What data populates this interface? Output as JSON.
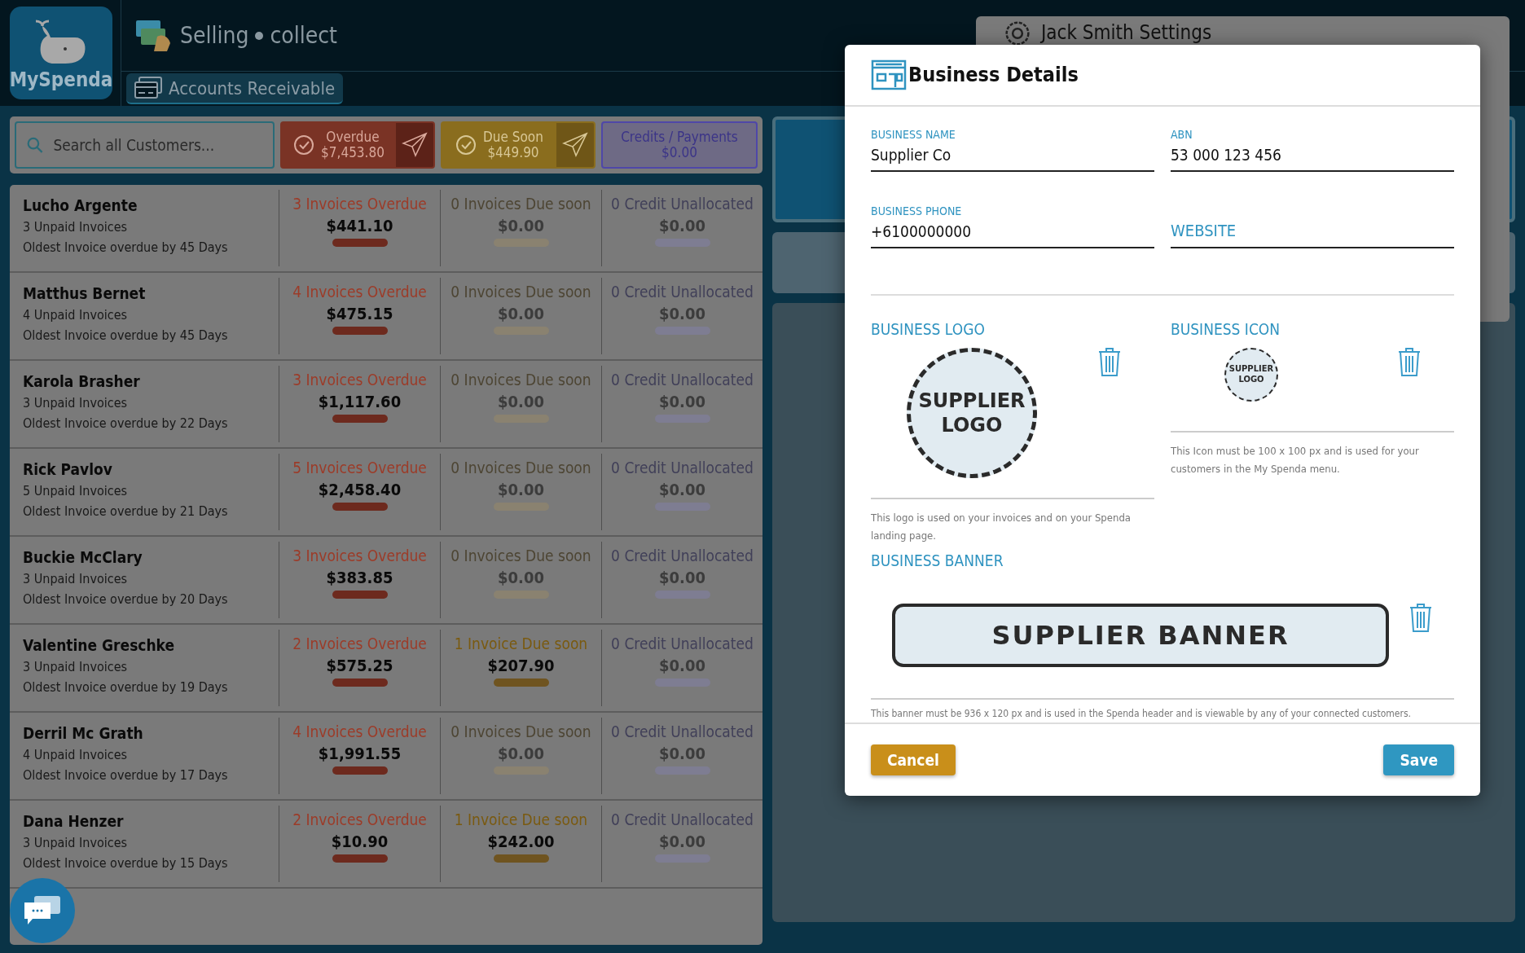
{
  "app": {
    "logo_text": "MySpenda",
    "section_title": "Selling",
    "section_subtitle": "collect",
    "tab": {
      "label": "Accounts Receivable",
      "selected": true
    }
  },
  "filters": {
    "search": {
      "placeholder": "Search all Customers..."
    },
    "buttons": [
      {
        "kind": "overdue",
        "label": "Overdue",
        "amount": "$7,453.80",
        "send": true
      },
      {
        "kind": "due",
        "label": "Due Soon",
        "amount": "$449.90",
        "send": true
      },
      {
        "kind": "credit",
        "label": "Credits / Payments",
        "amount": "$0.00",
        "send": false
      }
    ]
  },
  "customers": [
    {
      "name": "Lucho Argente",
      "unpaid": "3 Unpaid Invoices",
      "oldest": "Oldest Invoice overdue by 45 Days",
      "overdue": {
        "label": "3 Invoices Overdue",
        "amount": "$441.10",
        "active": true
      },
      "due": {
        "label": "0 Invoices Due soon",
        "amount": "$0.00",
        "active": false
      },
      "credit": {
        "label": "0 Credit Unallocated",
        "amount": "$0.00",
        "active": false
      }
    },
    {
      "name": "Matthus Bernet",
      "unpaid": "4 Unpaid Invoices",
      "oldest": "Oldest Invoice overdue by 45 Days",
      "overdue": {
        "label": "4 Invoices Overdue",
        "amount": "$475.15",
        "active": true
      },
      "due": {
        "label": "0 Invoices Due soon",
        "amount": "$0.00",
        "active": false
      },
      "credit": {
        "label": "0 Credit Unallocated",
        "amount": "$0.00",
        "active": false
      }
    },
    {
      "name": "Karola Brasher",
      "unpaid": "3 Unpaid Invoices",
      "oldest": "Oldest Invoice overdue by 22 Days",
      "overdue": {
        "label": "3 Invoices Overdue",
        "amount": "$1,117.60",
        "active": true
      },
      "due": {
        "label": "0 Invoices Due soon",
        "amount": "$0.00",
        "active": false
      },
      "credit": {
        "label": "0 Credit Unallocated",
        "amount": "$0.00",
        "active": false
      }
    },
    {
      "name": "Rick Pavlov",
      "unpaid": "5 Unpaid Invoices",
      "oldest": "Oldest Invoice overdue by 21 Days",
      "overdue": {
        "label": "5 Invoices Overdue",
        "amount": "$2,458.40",
        "active": true
      },
      "due": {
        "label": "0 Invoices Due soon",
        "amount": "$0.00",
        "active": false
      },
      "credit": {
        "label": "0 Credit Unallocated",
        "amount": "$0.00",
        "active": false
      }
    },
    {
      "name": "Buckie McClary",
      "unpaid": "3 Unpaid Invoices",
      "oldest": "Oldest Invoice overdue by 20 Days",
      "overdue": {
        "label": "3 Invoices Overdue",
        "amount": "$383.85",
        "active": true
      },
      "due": {
        "label": "0 Invoices Due soon",
        "amount": "$0.00",
        "active": false
      },
      "credit": {
        "label": "0 Credit Unallocated",
        "amount": "$0.00",
        "active": false
      }
    },
    {
      "name": "Valentine Greschke",
      "unpaid": "3 Unpaid Invoices",
      "oldest": "Oldest Invoice overdue by 19 Days",
      "overdue": {
        "label": "2 Invoices Overdue",
        "amount": "$575.25",
        "active": true
      },
      "due": {
        "label": "1 Invoice Due soon",
        "amount": "$207.90",
        "active": true
      },
      "credit": {
        "label": "0 Credit Unallocated",
        "amount": "$0.00",
        "active": false
      }
    },
    {
      "name": "Derril Mc Grath",
      "unpaid": "4 Unpaid Invoices",
      "oldest": "Oldest Invoice overdue by 17 Days",
      "overdue": {
        "label": "4 Invoices Overdue",
        "amount": "$1,991.55",
        "active": true
      },
      "due": {
        "label": "0 Invoices Due soon",
        "amount": "$0.00",
        "active": false
      },
      "credit": {
        "label": "0 Credit Unallocated",
        "amount": "$0.00",
        "active": false
      }
    },
    {
      "name": "Dana Henzer",
      "unpaid": "3 Unpaid Invoices",
      "oldest": "Oldest Invoice overdue by 15 Days",
      "overdue": {
        "label": "2 Invoices Overdue",
        "amount": "$10.90",
        "active": true
      },
      "due": {
        "label": "1 Invoice Due soon",
        "amount": "$242.00",
        "active": true
      },
      "credit": {
        "label": "0 Credit Unallocated",
        "amount": "$0.00",
        "active": false
      }
    }
  ],
  "settings_panel": {
    "title": "Jack Smith Settings"
  },
  "dialog": {
    "title": "Business Details",
    "fields": [
      {
        "label": "BUSINESS NAME",
        "value": "Supplier Co"
      },
      {
        "label": "ABN",
        "value": "53 000 123 456"
      },
      {
        "label": "BUSINESS PHONE",
        "value": "+6100000000"
      },
      {
        "placeholder": "WEBSITE"
      }
    ],
    "logo": {
      "label": "BUSINESS LOGO",
      "image_line1": "SUPPLIER",
      "image_line2": "LOGO",
      "hint": "This logo is used on your invoices and on your Spenda landing page."
    },
    "icon": {
      "label": "BUSINESS ICON",
      "image_line1": "SUPPLIER",
      "image_line2": "LOGO",
      "hint": "This Icon must be 100 x 100 px and is used for your customers in the My Spenda menu."
    },
    "banner": {
      "label": "BUSINESS BANNER",
      "image_text": "SUPPLIER BANNER",
      "hint": "This banner must be 936 x 120 px and is used in the Spenda header and is viewable by any of your connected customers."
    },
    "buttons": [
      {
        "kind": "cancel",
        "label": "Cancel"
      },
      {
        "kind": "save",
        "label": "Save"
      }
    ]
  }
}
